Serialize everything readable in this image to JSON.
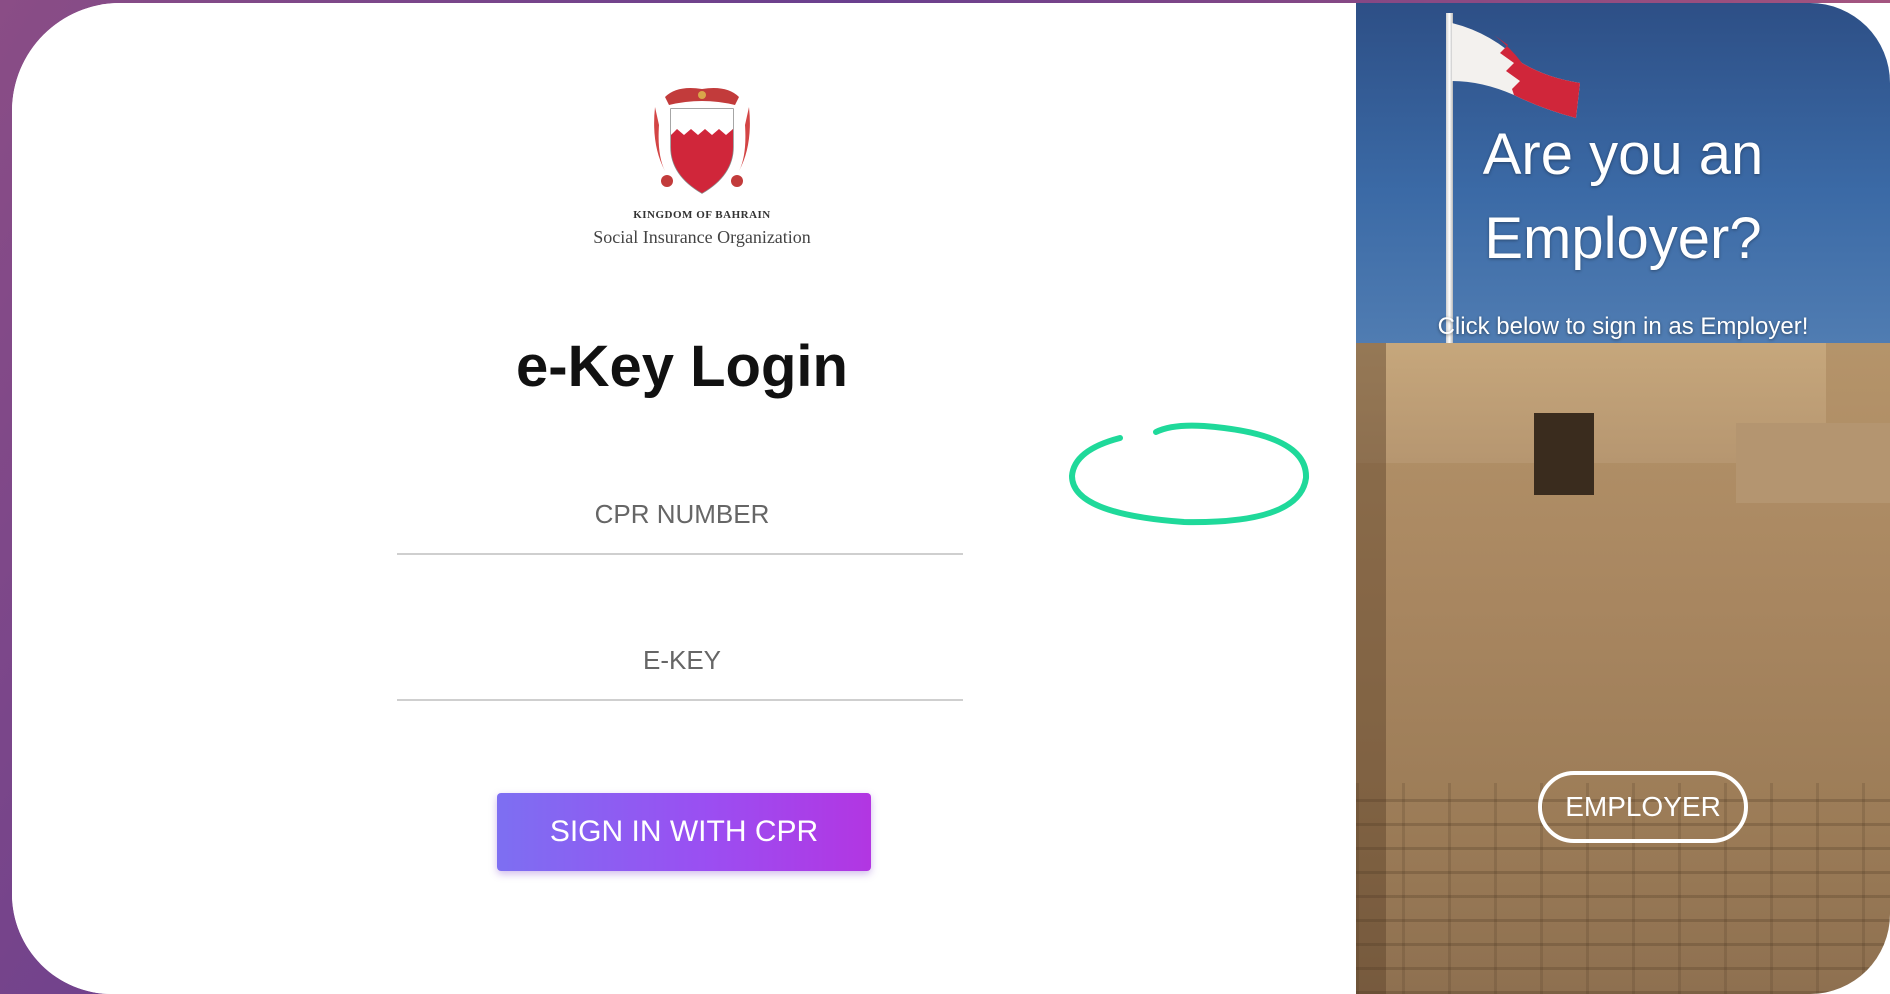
{
  "logo": {
    "line1": "KINGDOM OF BAHRAIN",
    "line2": "Social Insurance Organization"
  },
  "login": {
    "title": "e-Key Login",
    "cpr_placeholder": "CPR NUMBER",
    "ekey_placeholder": "E-KEY",
    "signin_label": "SIGN IN WITH CPR"
  },
  "promo": {
    "question_line1": "Are you an",
    "question_line2": "Employer?",
    "subtitle": "Click below to sign in as Employer!",
    "employer_label": "EMPLOYER"
  },
  "colors": {
    "signin_gradient_start": "#7d6ff2",
    "signin_gradient_end": "#b236e2",
    "annotation_circle": "#1fd99a",
    "flag_red": "#d0263a"
  }
}
